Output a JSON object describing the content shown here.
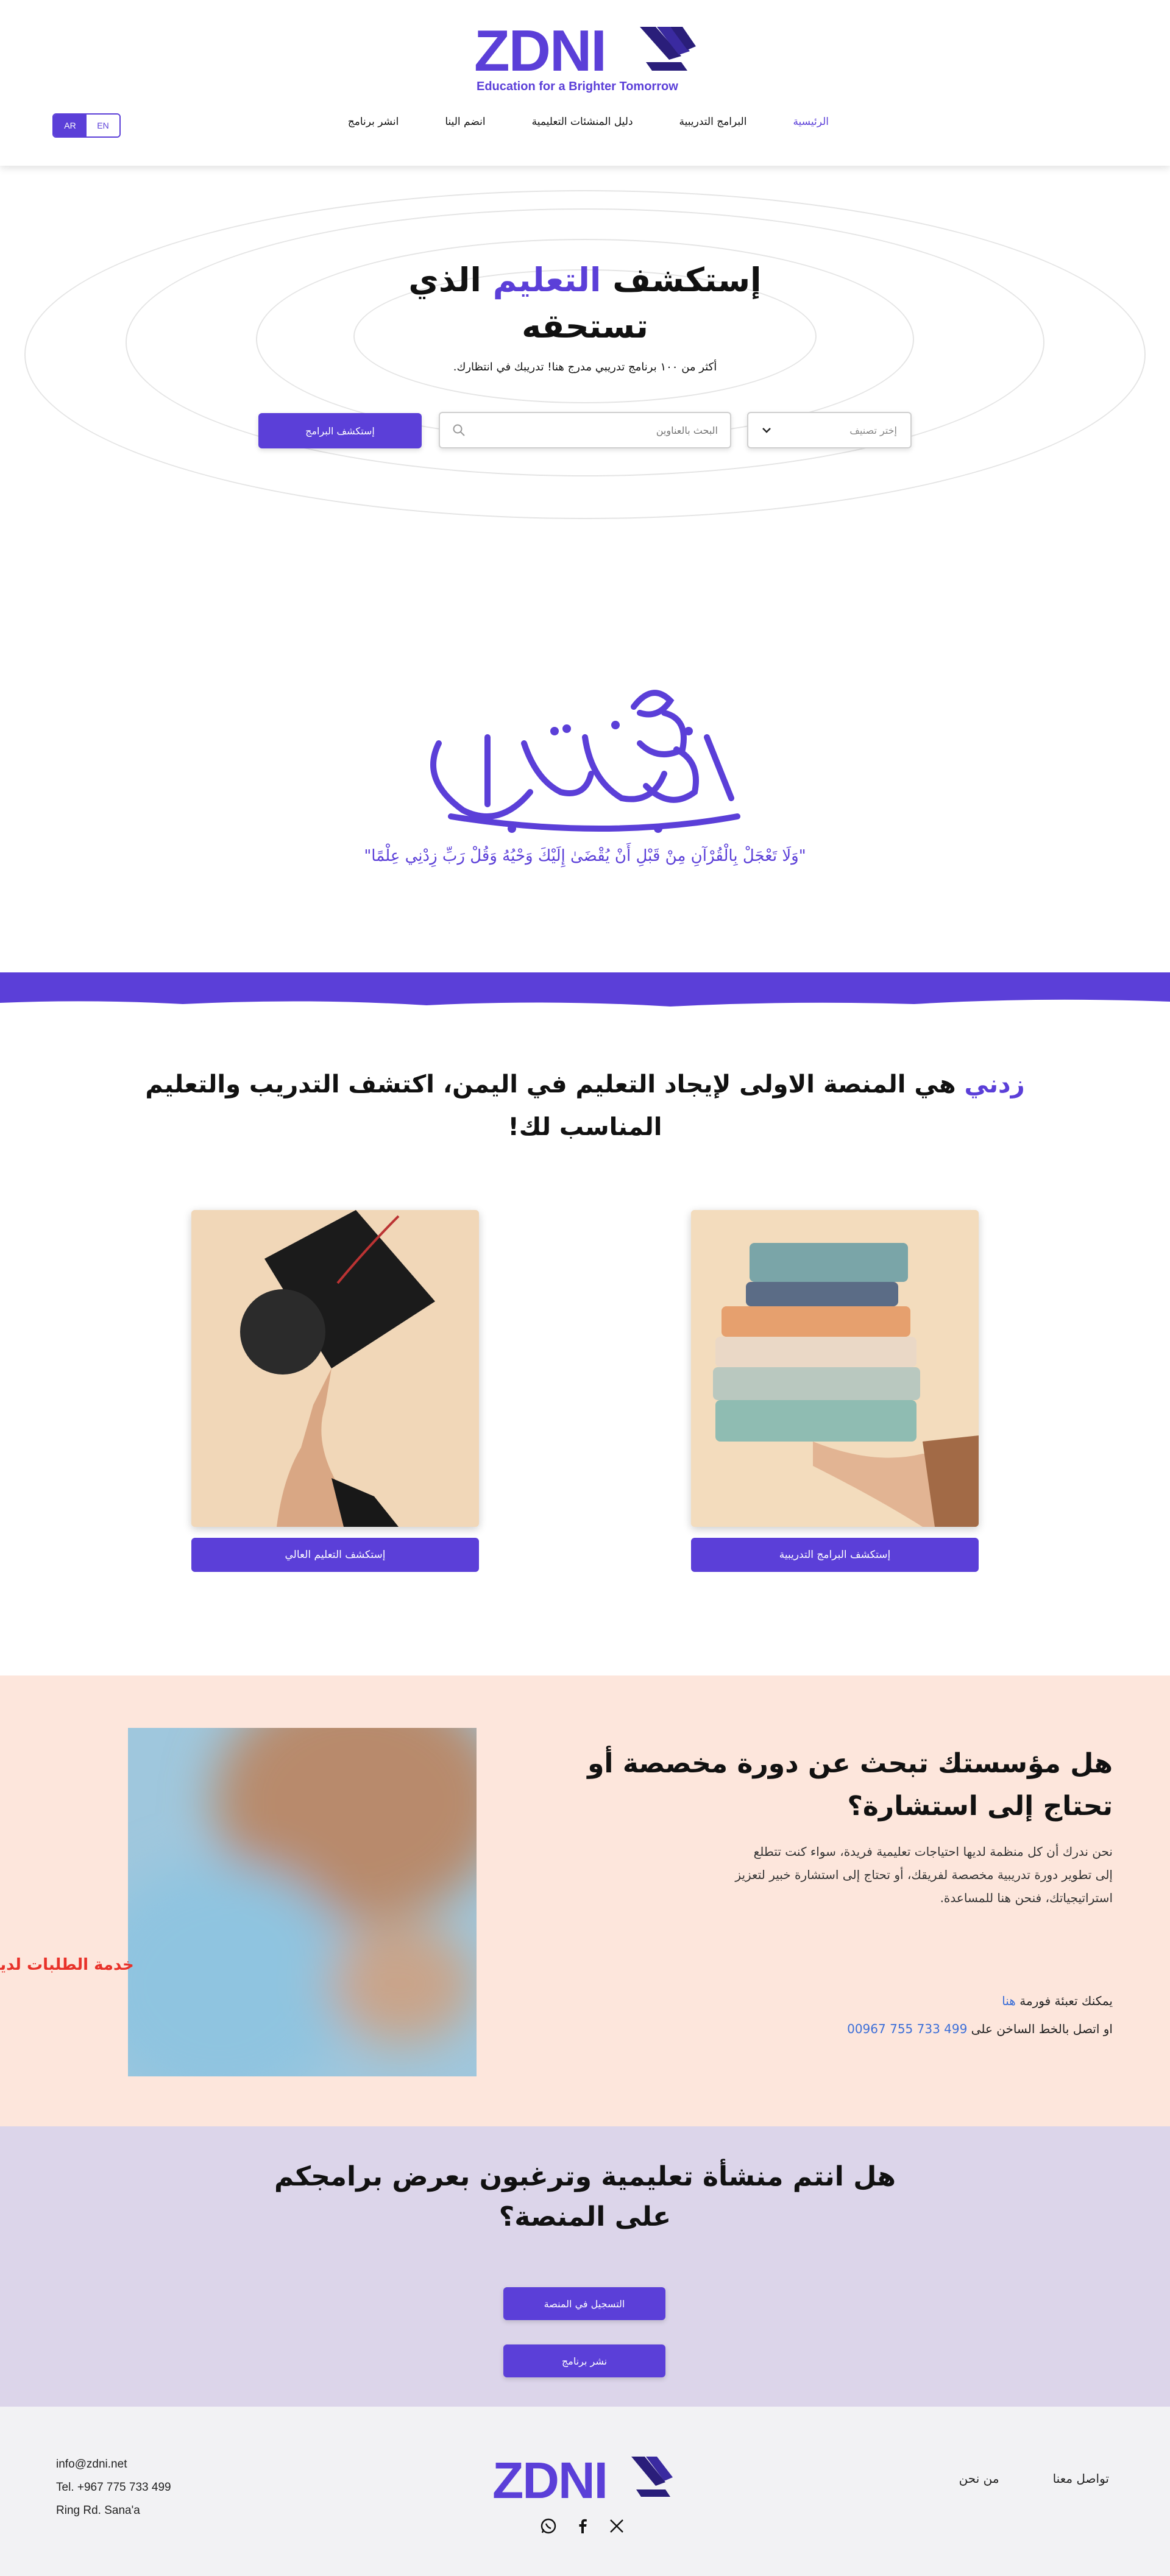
{
  "brand": {
    "name": "ZDNI",
    "tagline": "Education for a Brighter Tomorrow",
    "color": "#5b3fd8"
  },
  "header": {
    "lang_ar": "AR",
    "lang_en": "EN",
    "nav": [
      {
        "label": "الرئيسية",
        "active": true
      },
      {
        "label": "البرامج التدريبية",
        "active": false
      },
      {
        "label": "دليل المنشئات التعليمية",
        "active": false
      },
      {
        "label": "انضم الينا",
        "active": false
      },
      {
        "label": "انشر برنامج",
        "active": false
      }
    ]
  },
  "hero": {
    "title_part1": "إستكشف ",
    "title_accent": "التعليم",
    "title_part2": " الذي",
    "title_line2": "تستحقه",
    "subtitle": "أكثر من ١٠٠ برنامج تدريبي مدرج هنا! تدريبك في انتظارك.",
    "category_placeholder": "إختر تصنيف",
    "search_placeholder": "البحث بالعناوين",
    "explore_button": "إستكشف البرامج"
  },
  "verse": "\"وَلَا تَعْجَلْ بِالْقُرْآنِ مِنْ قَبْلِ أَنْ يُقْضَىٰ إِلَيْكَ وَحْيُهُ وَقُلْ رَبِّ زِدْنِي عِلْمًا\"",
  "intro": {
    "accent": "زدني",
    "line1": " هي المنصة الاولى لإيجاد التعليم في اليمن، اكتشف التدريب والتعليم",
    "line2": "المناسب لك!",
    "btn_programs": "إستكشف البرامج التدريبية",
    "btn_higher": "إستكشف التعليم العالي"
  },
  "consult": {
    "title_line1": "هل مؤسستك تبحث عن دورة مخصصة أو",
    "title_line2": "تحتاج إلى استشارة؟",
    "text_line1": "نحن ندرك أن كل منظمة لديها احتياجات تعليمية فريدة، سواء كنت تتطلع",
    "text_line2": "إلى تطوير دورة تدريبية مخصصة لفريقك، أو تحتاج إلى استشارة خبير لتعزيز",
    "text_line3": "استراتيجياتك، فنحن هنا للمساعدة.",
    "form_prefix": "يمكنك تعبئة فورمة ",
    "form_link": "هنا",
    "phone_prefix": "او اتصل بالخط الساخن على ",
    "phone": "00967 755 733 499",
    "side_tab": "خدمة الطلبات لدينا"
  },
  "institutions": {
    "title_line1": "هل انتم منشأة تعليمية وترغبون بعرض برامجكم",
    "title_line2": "على المنصة؟",
    "btn_register": "التسجيل في المنصة",
    "btn_publish": "نشر برنامج"
  },
  "footer": {
    "email": "info@zdni.net",
    "tel": "Tel. +967 775 733 499",
    "address": "Ring Rd. Sana'a",
    "links": [
      "تواصل معنا",
      "من نحن"
    ],
    "social": [
      "whatsapp-icon",
      "facebook-icon",
      "x-icon"
    ]
  }
}
